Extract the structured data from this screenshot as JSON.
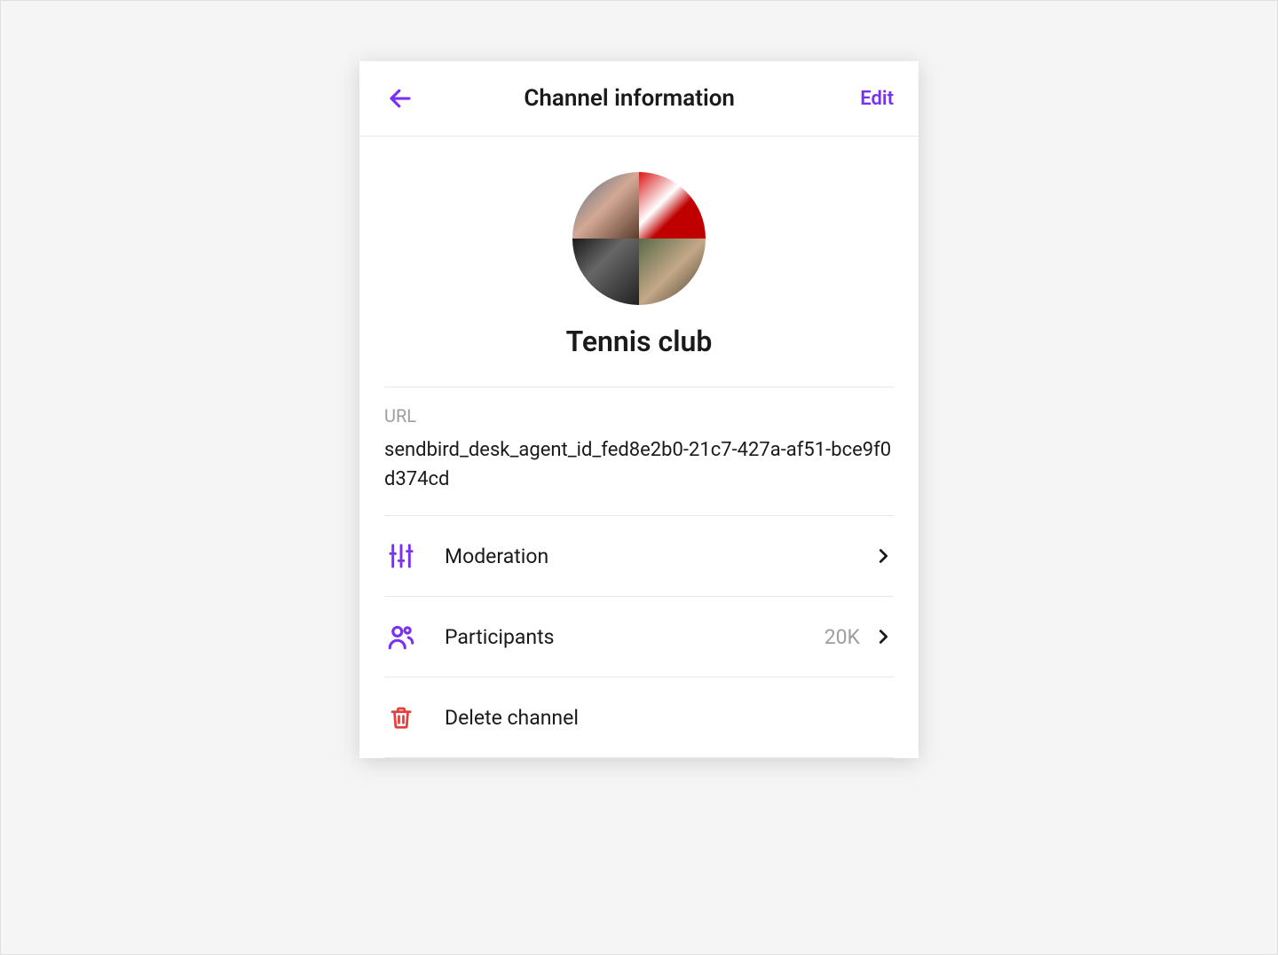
{
  "header": {
    "title": "Channel information",
    "edit_label": "Edit"
  },
  "channel": {
    "name": "Tennis club"
  },
  "url": {
    "label": "URL",
    "value": "sendbird_desk_agent_id_fed8e2b0-21c7-427a-af51-bce9f0d374cd"
  },
  "items": {
    "moderation": {
      "label": "Moderation"
    },
    "participants": {
      "label": "Participants",
      "count": "20K"
    },
    "delete": {
      "label": "Delete channel"
    }
  },
  "colors": {
    "accent": "#7a2ff5",
    "danger": "#e53e3e"
  }
}
